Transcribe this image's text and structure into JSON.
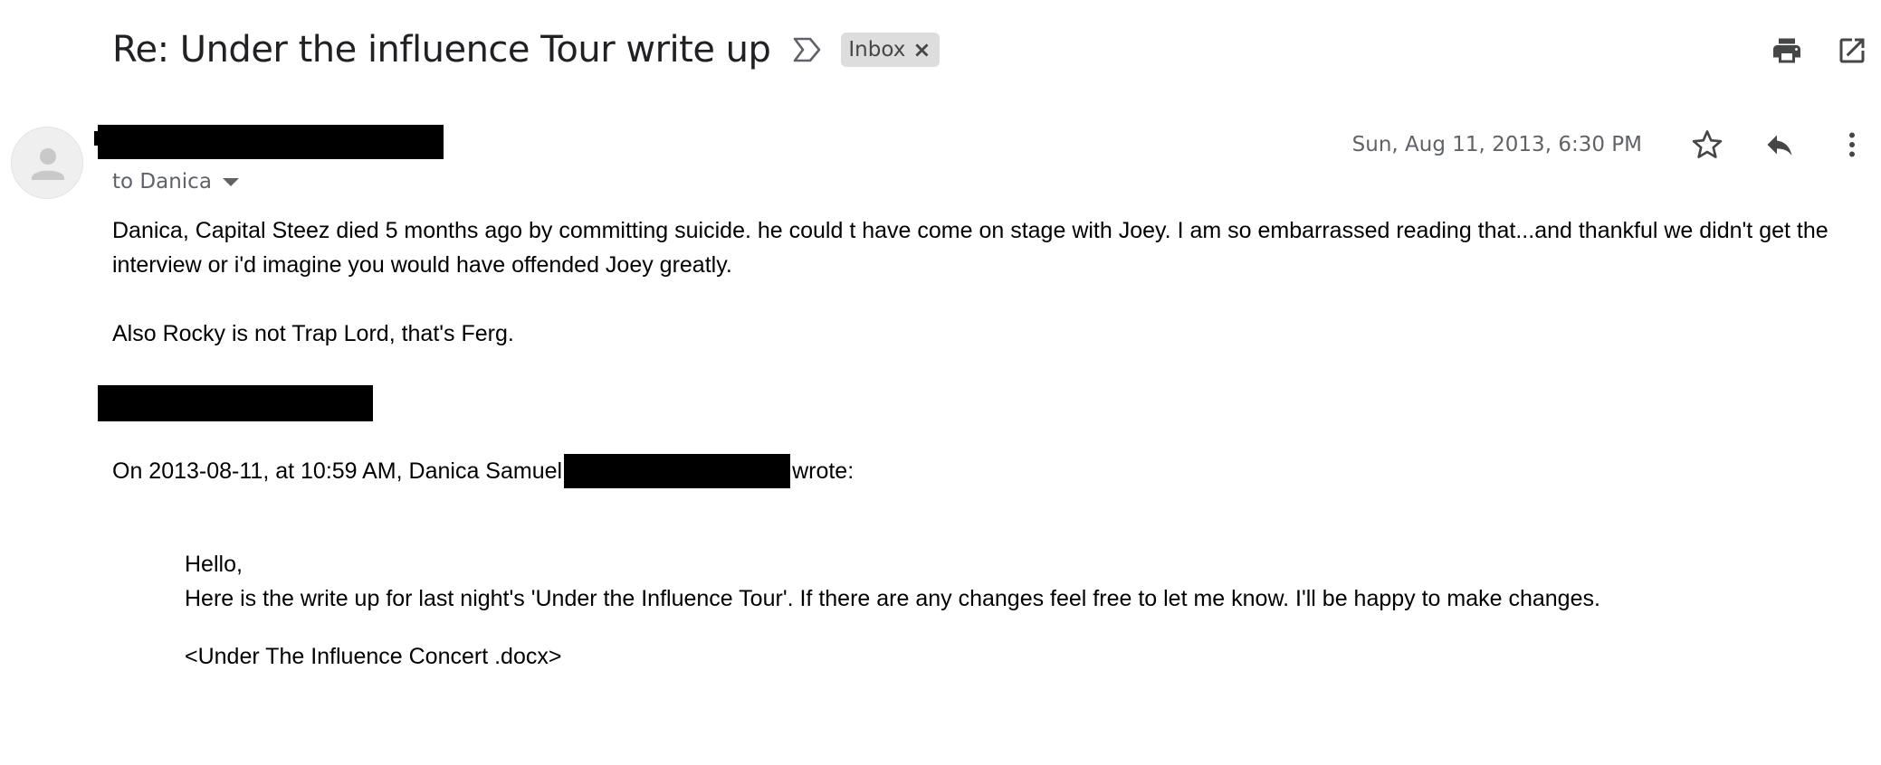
{
  "header": {
    "subject": "Re: Under the influence Tour write up",
    "label_chip": "Inbox",
    "label_chip_close": "×",
    "actions": [
      "print-icon",
      "open-in-new-window-icon"
    ]
  },
  "message": {
    "sender_name": "",
    "to_line": "to Danica",
    "date": "Sun, Aug 11, 2013, 6:30 PM",
    "actions": [
      "star-icon",
      "reply-icon",
      "more-vert-icon"
    ],
    "body": {
      "paragraph1": "Danica, Capital Steez died 5 months ago by committing suicide. he could t have come on stage with Joey. I am so embarrassed reading that...and thankful we didn't get the interview or i'd imagine you would have offended Joey greatly.",
      "paragraph2": "Also Rocky is not Trap Lord, that's Ferg."
    },
    "quote": {
      "header_prefix": "On 2013-08-11, at 10:59 AM, Danica Samuel",
      "header_suffix": "wrote:",
      "greeting": "Hello,",
      "body": "Here is the write up for last night's 'Under the Influence Tour'. If there are any changes feel free to let me know. I'll be happy to make changes.",
      "attachment": "<Under The Influence Concert .docx>"
    }
  },
  "colors": {
    "text": "#202124",
    "muted": "#5f6368",
    "chip_bg": "#dddddd",
    "redaction": "#000000"
  }
}
